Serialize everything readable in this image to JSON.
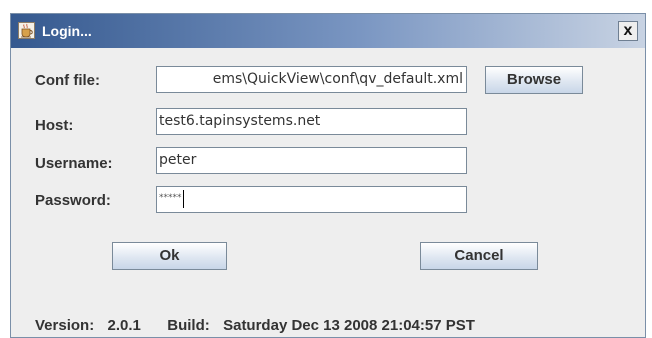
{
  "window": {
    "title": "Login...",
    "close_label": "x"
  },
  "form": {
    "conf_file": {
      "label": "Conf file:",
      "value": "ems\\QuickView\\conf\\qv_default.xml"
    },
    "host": {
      "label": "Host:",
      "value": "test6.tapinsystems.net"
    },
    "username": {
      "label": "Username:",
      "value": "peter"
    },
    "password": {
      "label": "Password:",
      "mask": "*****"
    }
  },
  "buttons": {
    "browse": "Browse",
    "ok": "Ok",
    "cancel": "Cancel"
  },
  "footer": {
    "version_label": "Version:",
    "version": "2.0.1",
    "build_label": "Build:",
    "build": "Saturday Dec 13 2008 21:04:57 PST"
  },
  "icons": {
    "title": "java-cup-icon",
    "close": "close-icon"
  },
  "colors": {
    "title_bar_start": "#35598f",
    "title_bar_end": "#c8d3e3",
    "dialog_background": "#eeeeee",
    "button_gradient_end": "#c8d6e8"
  }
}
